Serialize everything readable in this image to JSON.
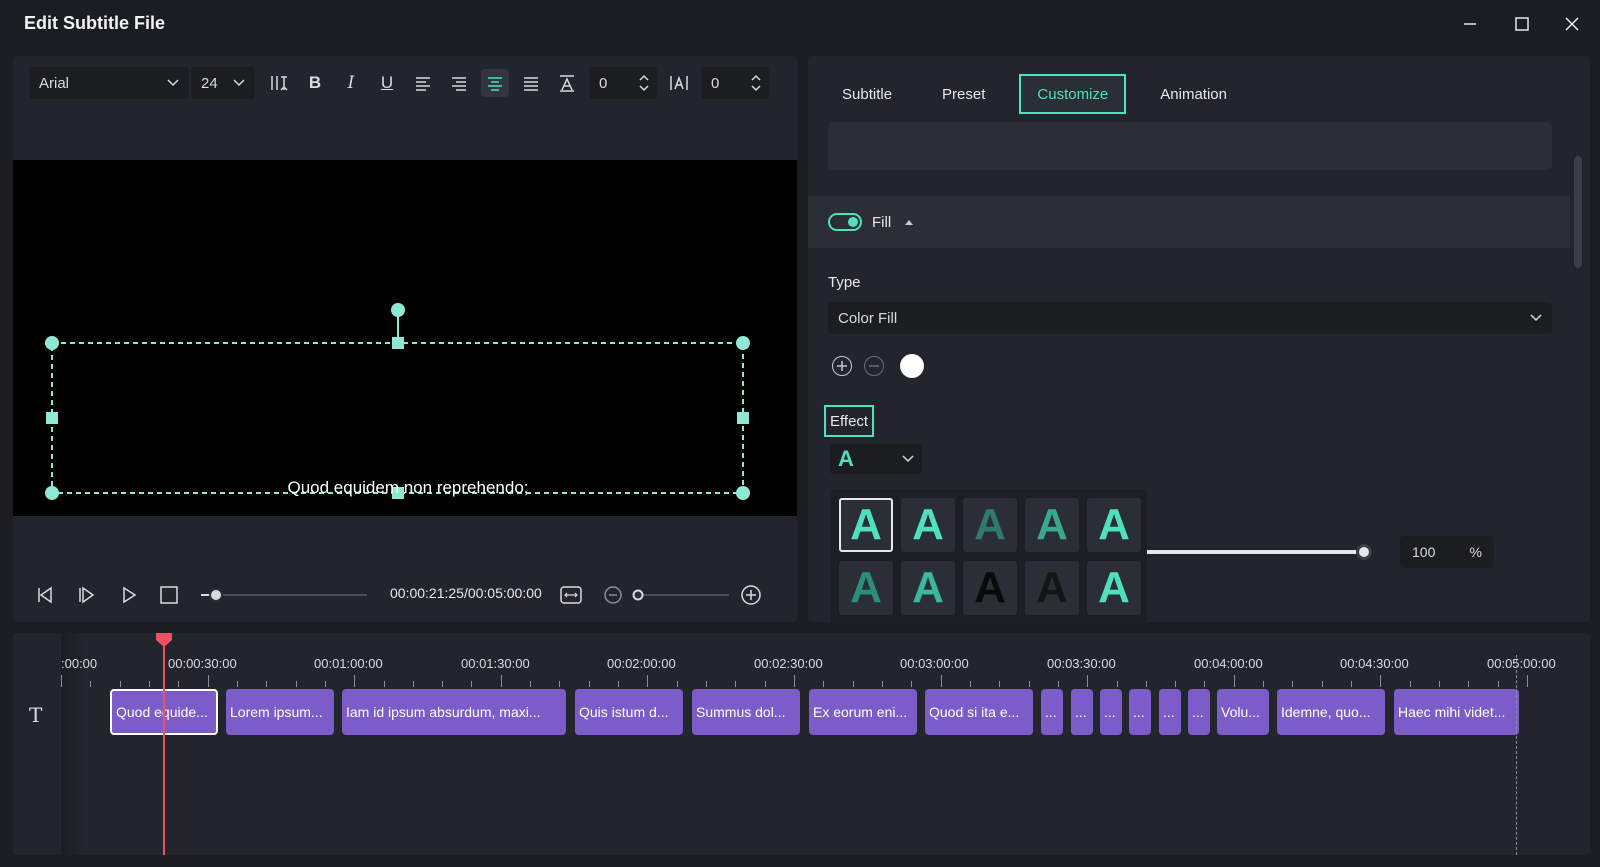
{
  "window": {
    "title": "Edit Subtitle File",
    "minimize_icon": "minimize-icon",
    "maximize_icon": "maximize-icon",
    "close_icon": "close-icon"
  },
  "toolbar": {
    "font": "Arial",
    "size": "24",
    "char_spacing": "0",
    "line_spacing": "0"
  },
  "preview": {
    "subtitle_text": "Quod equidem non reprehendo;"
  },
  "player": {
    "timecode": "00:00:21:25/00:05:00:00"
  },
  "tabs": [
    "Subtitle",
    "Preset",
    "Customize",
    "Animation"
  ],
  "active_tab": "Customize",
  "fill": {
    "label": "Fill",
    "enabled": true
  },
  "type": {
    "label": "Type",
    "value": "Color Fill"
  },
  "effect": {
    "label": "Effect",
    "selected_glyph": "A",
    "grid_glyph": "A"
  },
  "opacity": {
    "value": "100",
    "unit": "%",
    "fraction": 1.0
  },
  "colors": {
    "accent": "#4fe0c0",
    "clip": "#7b5cc9",
    "playhead": "#f05060",
    "swatch": "#ffffff"
  },
  "timeline": {
    "ruler": [
      ":00:00",
      "00:00:30:00",
      "00:01:00:00",
      "00:01:30:00",
      "00:02:00:00",
      "00:02:30:00",
      "00:03:00:00",
      "00:03:30:00",
      "00:04:00:00",
      "00:04:30:00",
      "00:05:00:00"
    ],
    "clips": [
      "Quod equide...",
      "Lorem ipsum...",
      "Iam id ipsum absurdum, maxi...",
      "Quis istum d...",
      "Summus dol...",
      "Ex eorum eni...",
      "Quod si ita e...",
      "...",
      "...",
      "...",
      "...",
      "...",
      "...",
      "Volu...",
      "Idemne, quo...",
      "Haec mihi videt..."
    ],
    "track_icon": "text-track-icon"
  }
}
